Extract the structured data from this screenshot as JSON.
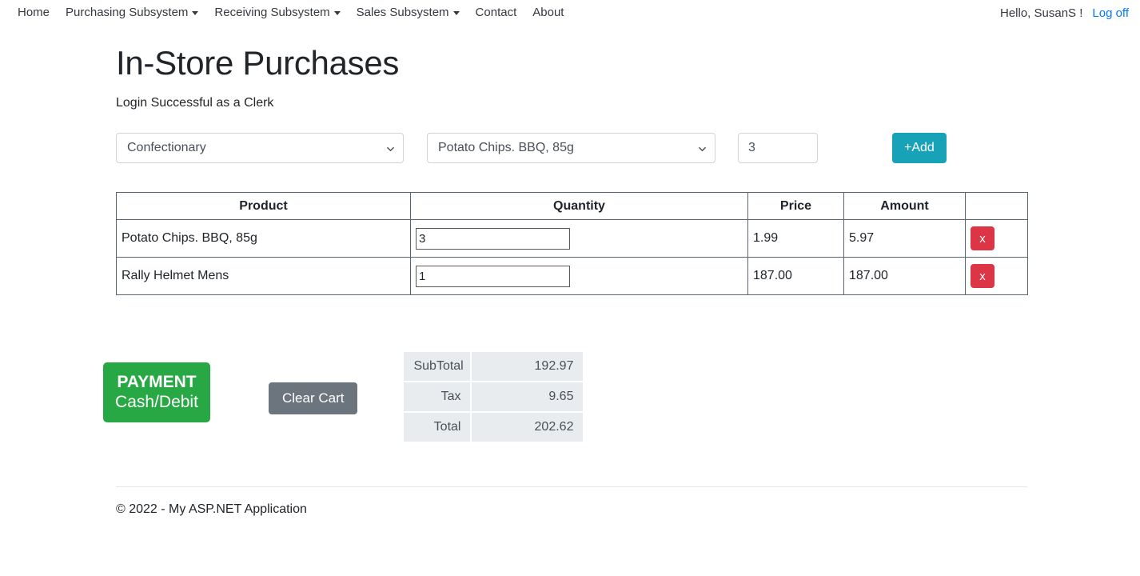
{
  "navbar": {
    "items": [
      {
        "label": "Home",
        "has_caret": false
      },
      {
        "label": "Purchasing Subsystem",
        "has_caret": true
      },
      {
        "label": "Receiving Subsystem",
        "has_caret": true
      },
      {
        "label": "Sales Subsystem",
        "has_caret": true
      },
      {
        "label": "Contact",
        "has_caret": false
      },
      {
        "label": "About",
        "has_caret": false
      }
    ],
    "greeting": "Hello, SusanS !",
    "logoff_label": "Log off",
    "link_color": "#007bff"
  },
  "page": {
    "title": "In-Store Purchases",
    "subtitle": "Login Successful as a Clerk"
  },
  "form": {
    "category_select": {
      "value": "Confectionary"
    },
    "product_select": {
      "value": "Potato Chips. BBQ, 85g"
    },
    "quantity_input": {
      "value": "3",
      "placeholder": ""
    },
    "add_button": {
      "label": "+Add",
      "color": "#17a2b8"
    }
  },
  "cart_table": {
    "columns": [
      "Product",
      "Quantity",
      "Price",
      "Amount",
      ""
    ],
    "rows": [
      {
        "product": "Potato Chips. BBQ, 85g",
        "quantity": "3",
        "price": "1.99",
        "amount": "5.97",
        "remove_label": "x"
      },
      {
        "product": "Rally Helmet Mens",
        "quantity": "1",
        "price": "187.00",
        "amount": "187.00",
        "remove_label": "x"
      }
    ],
    "remove_color": "#dc3545"
  },
  "actions": {
    "payment_button": {
      "line1": "PAYMENT",
      "line2": "Cash/Debit",
      "color": "#28a745"
    },
    "clear_cart_button": {
      "label": "Clear Cart",
      "color": "#6c757d"
    }
  },
  "totals": {
    "rows": [
      {
        "label": "SubTotal",
        "value": "192.97"
      },
      {
        "label": "Tax",
        "value": "9.65"
      },
      {
        "label": "Total",
        "value": "202.62"
      }
    ]
  },
  "footer": {
    "text": "© 2022 - My ASP.NET Application"
  }
}
